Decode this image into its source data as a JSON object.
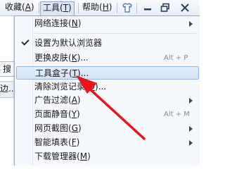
{
  "menubar": {
    "favorites": {
      "text": "收藏",
      "key": "A"
    },
    "tools": {
      "text": "工具",
      "key": "T"
    },
    "help": {
      "text": "帮助",
      "key": "H"
    }
  },
  "toolbar_icons": [
    "shirt-icon",
    "minimize-icon",
    "restore-icon",
    "close-icon"
  ],
  "background_page": {
    "row1_text": "搜",
    "row2_text": "边..."
  },
  "menu": {
    "items": [
      {
        "id": "network",
        "label": "网络连接",
        "key": "N",
        "suffix": "",
        "shortcut": "",
        "submenu": true,
        "checked": false
      },
      {
        "id": "set-default",
        "label": "设置为默认浏览器",
        "key": "",
        "suffix": "",
        "shortcut": "",
        "submenu": false,
        "checked": true
      },
      {
        "id": "change-skin",
        "label": "更换皮肤",
        "key": "K",
        "suffix": "...",
        "shortcut": "Alt + P",
        "submenu": false,
        "checked": false
      },
      {
        "id": "toolbox",
        "label": "工具盒子",
        "key": "T",
        "suffix": "...",
        "shortcut": "",
        "submenu": false,
        "checked": false,
        "highlighted": true
      },
      {
        "id": "clear-history",
        "label": "清除浏览记录",
        "key": "D",
        "suffix": "...",
        "shortcut": "",
        "submenu": false,
        "checked": false
      },
      {
        "id": "ad-filter",
        "label": "广告过滤",
        "key": "A",
        "suffix": "",
        "shortcut": "",
        "submenu": true,
        "checked": false
      },
      {
        "id": "mute",
        "label": "页面静音",
        "key": "Y",
        "suffix": "",
        "shortcut": "Alt + M",
        "submenu": false,
        "checked": false
      },
      {
        "id": "screenshot",
        "label": "网页截图",
        "key": "G",
        "suffix": "",
        "shortcut": "",
        "submenu": true,
        "checked": false
      },
      {
        "id": "autofill",
        "label": "智能填表",
        "key": "F",
        "suffix": "",
        "shortcut": "",
        "submenu": true,
        "checked": false
      },
      {
        "id": "downloads",
        "label": "下载管理器",
        "key": "M",
        "suffix": "",
        "shortcut": "",
        "submenu": false,
        "checked": false
      }
    ]
  },
  "colors": {
    "annotation_arrow": "#e8141a",
    "highlight_border": "#98b8e3"
  }
}
